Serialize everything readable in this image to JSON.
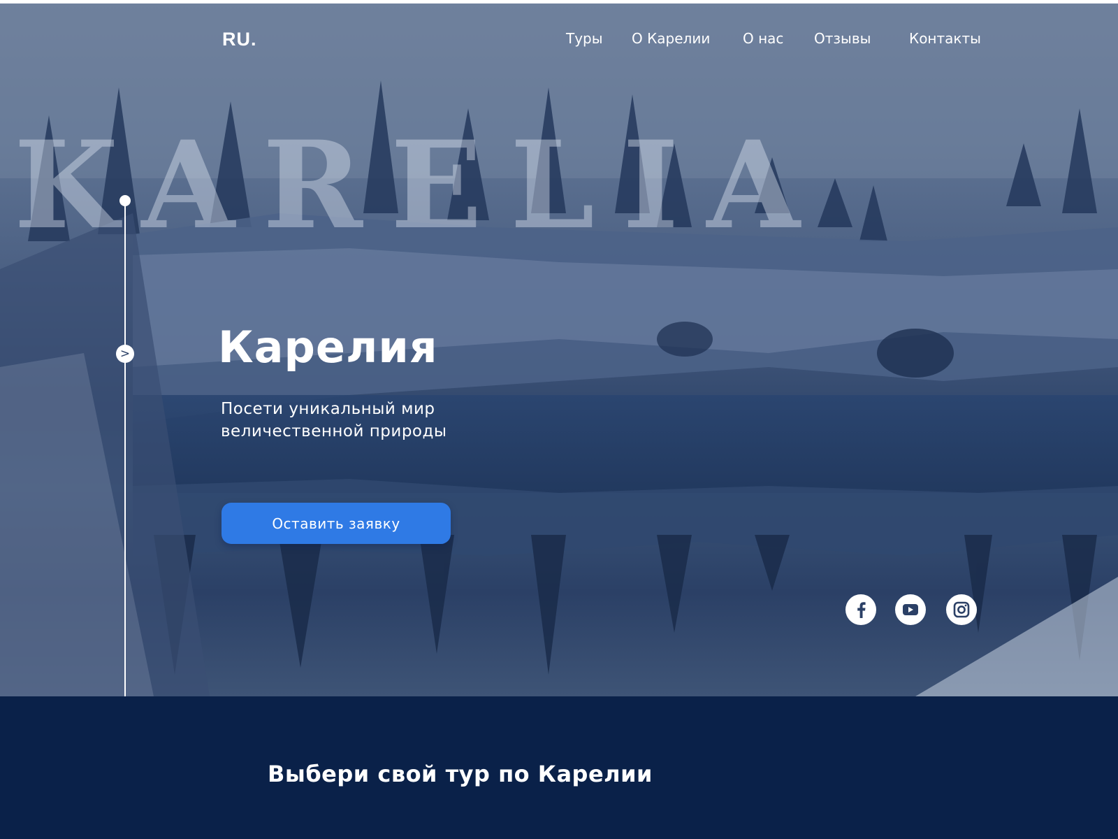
{
  "header": {
    "logo": "RU.",
    "nav": [
      "Туры",
      "О Карелии",
      "О нас",
      "Отзывы",
      "Контакты"
    ]
  },
  "hero": {
    "watermark": "KARELIA",
    "title": "Карелия",
    "subtitle_line1": "Посети уникальный мир",
    "subtitle_line2": "величественной природы",
    "cta_label": "Оставить заявку",
    "timeline_arrow": ">"
  },
  "social": {
    "icons": [
      "facebook-icon",
      "youtube-icon",
      "instagram-icon"
    ]
  },
  "section": {
    "title": "Выбери свой тур по Карелии"
  },
  "colors": {
    "accent": "#2f7ae5",
    "dark_navy": "#0a2149",
    "text": "#ffffff"
  }
}
